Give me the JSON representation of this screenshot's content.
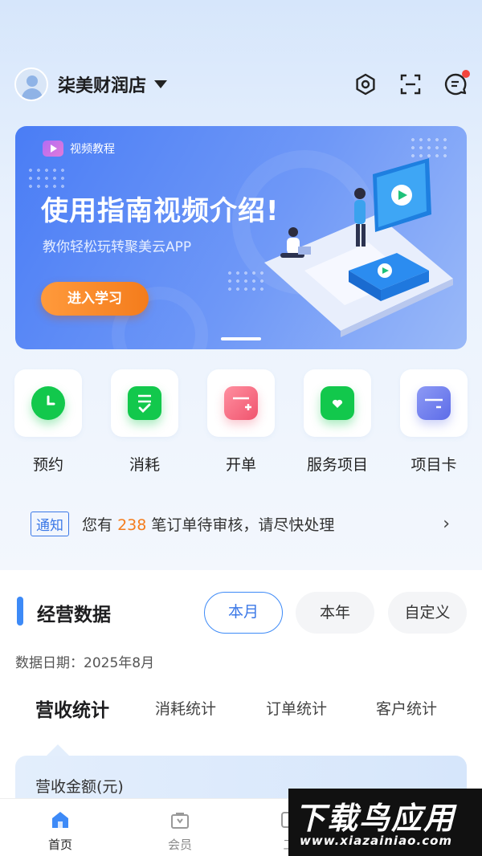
{
  "header": {
    "store_name": "柒美财润店"
  },
  "banner": {
    "tag": "视频教程",
    "title": "使用指南视频介绍!",
    "subtitle": "教你轻松玩转聚美云APP",
    "button_label": "进入学习"
  },
  "quick_actions": [
    {
      "label": "预约",
      "icon": "clock-icon",
      "color": "#12c84c"
    },
    {
      "label": "消耗",
      "icon": "checklist-icon",
      "color": "#12c84c"
    },
    {
      "label": "开单",
      "icon": "add-order-icon",
      "color": "#f26a7e"
    },
    {
      "label": "服务项目",
      "icon": "heart-box-icon",
      "color": "#12c84c"
    },
    {
      "label": "项目卡",
      "icon": "card-icon",
      "color": "#6b7cf0"
    }
  ],
  "notice": {
    "tag": "通知",
    "prefix": "您有",
    "count": "238",
    "suffix": "笔订单待审核，请尽快处理"
  },
  "business_data": {
    "title": "经营数据",
    "periods": [
      "本月",
      "本年",
      "自定义"
    ],
    "active_period": "本月",
    "date_label": "数据日期：2025年8月",
    "stat_tabs": [
      "营收统计",
      "消耗统计",
      "订单统计",
      "客户统计"
    ],
    "active_stat_tab": "营收统计",
    "revenue_label": "营收金额(元)"
  },
  "bottom_nav": [
    {
      "label": "首页",
      "icon": "home-icon",
      "active": true
    },
    {
      "label": "会员",
      "icon": "member-bag-icon",
      "active": false
    },
    {
      "label": "工",
      "icon": "tool-icon",
      "active": false
    }
  ],
  "watermark": {
    "logo": "下载鸟应用",
    "url": "www.xiazainiao.com"
  }
}
